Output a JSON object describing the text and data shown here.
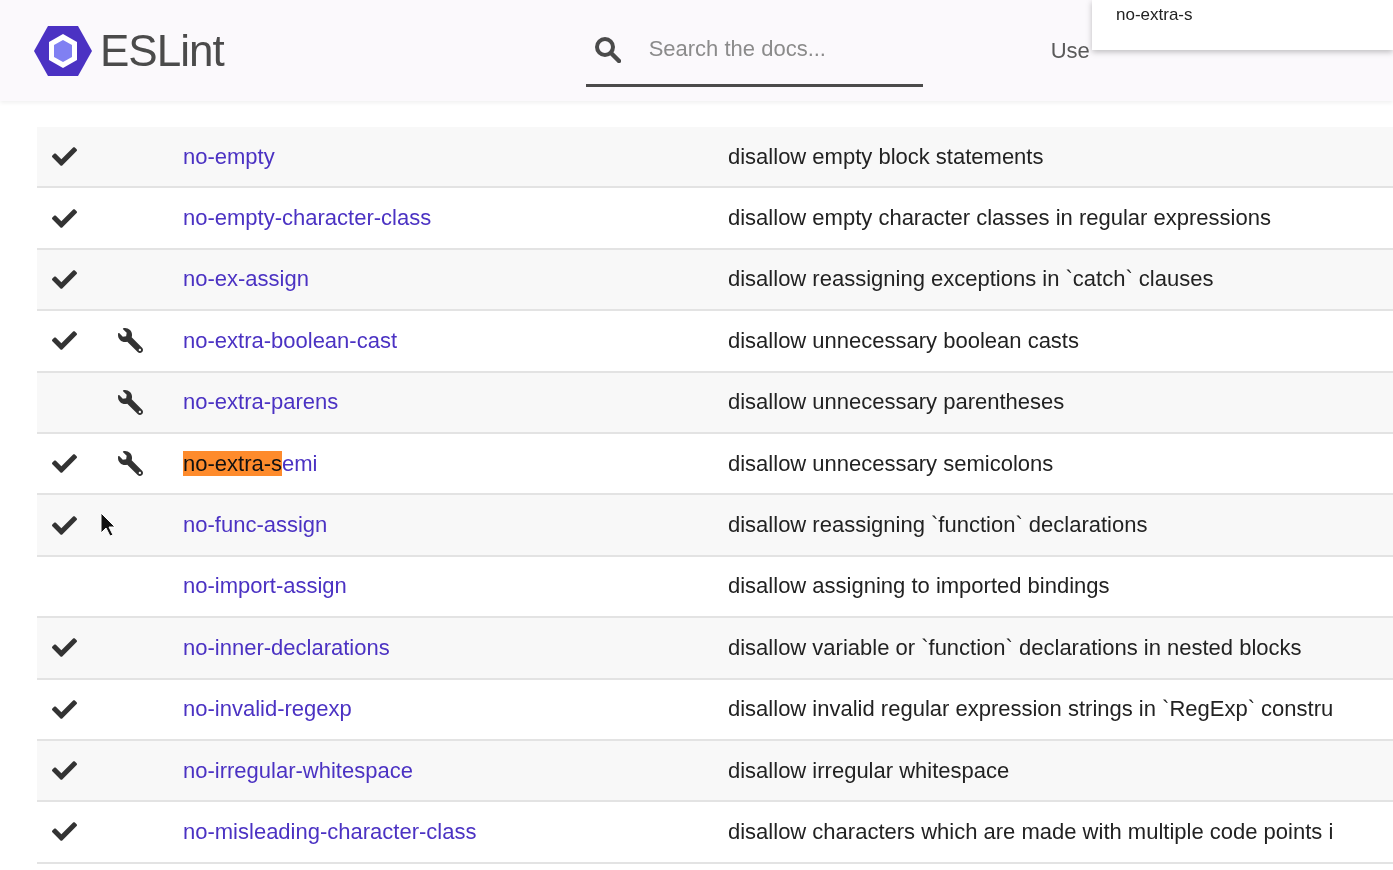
{
  "header": {
    "logo_text": "ESLint",
    "search": {
      "placeholder": "Search the docs..."
    },
    "nav": [
      "Use"
    ],
    "search_popup": {
      "suggestion": "no-extra-s"
    }
  },
  "rules": [
    {
      "recommended": true,
      "fixable": false,
      "name_parts": [
        {
          "text": "no-empty",
          "highlighted": false
        }
      ],
      "description": "disallow empty block statements"
    },
    {
      "recommended": true,
      "fixable": false,
      "name_parts": [
        {
          "text": "no-empty-character-class",
          "highlighted": false
        }
      ],
      "description": "disallow empty character classes in regular expressions"
    },
    {
      "recommended": true,
      "fixable": false,
      "name_parts": [
        {
          "text": "no-ex-assign",
          "highlighted": false
        }
      ],
      "description": "disallow reassigning exceptions in `catch` clauses"
    },
    {
      "recommended": true,
      "fixable": true,
      "name_parts": [
        {
          "text": "no-extra-boolean-cast",
          "highlighted": false
        }
      ],
      "description": "disallow unnecessary boolean casts"
    },
    {
      "recommended": false,
      "fixable": true,
      "name_parts": [
        {
          "text": "no-extra-parens",
          "highlighted": false
        }
      ],
      "description": "disallow unnecessary parentheses"
    },
    {
      "recommended": true,
      "fixable": true,
      "name_parts": [
        {
          "text": "no-extra-s",
          "highlighted": true
        },
        {
          "text": "emi",
          "highlighted": false
        }
      ],
      "description": "disallow unnecessary semicolons"
    },
    {
      "recommended": true,
      "fixable": false,
      "name_parts": [
        {
          "text": "no-func-assign",
          "highlighted": false
        }
      ],
      "description": "disallow reassigning `function` declarations"
    },
    {
      "recommended": false,
      "fixable": false,
      "name_parts": [
        {
          "text": "no-import-assign",
          "highlighted": false
        }
      ],
      "description": "disallow assigning to imported bindings"
    },
    {
      "recommended": true,
      "fixable": false,
      "name_parts": [
        {
          "text": "no-inner-declarations",
          "highlighted": false
        }
      ],
      "description": "disallow variable or `function` declarations in nested blocks"
    },
    {
      "recommended": true,
      "fixable": false,
      "name_parts": [
        {
          "text": "no-invalid-regexp",
          "highlighted": false
        }
      ],
      "description": "disallow invalid regular expression strings in `RegExp` constru"
    },
    {
      "recommended": true,
      "fixable": false,
      "name_parts": [
        {
          "text": "no-irregular-whitespace",
          "highlighted": false
        }
      ],
      "description": "disallow irregular whitespace"
    },
    {
      "recommended": true,
      "fixable": false,
      "name_parts": [
        {
          "text": "no-misleading-character-class",
          "highlighted": false
        }
      ],
      "description": "disallow characters which are made with multiple code points i"
    }
  ]
}
